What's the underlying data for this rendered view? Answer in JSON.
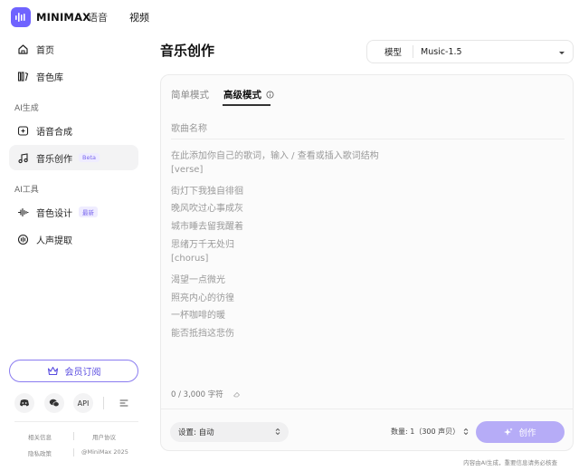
{
  "brand": {
    "name": "MINIMAX"
  },
  "top_nav": {
    "speech": "语音",
    "video": "视频"
  },
  "sidebar": {
    "home": "首页",
    "voice_library": "音色库",
    "section_ai_gen": "AI生成",
    "speech_synthesis": "语音合成",
    "music_creation": "音乐创作",
    "beta_badge": "Beta",
    "section_ai_tools": "AI工具",
    "voice_design": "音色设计",
    "new_badge": "最新",
    "vocal_extraction": "人声提取",
    "vip_button": "会员订阅",
    "api_label": "API",
    "footer": {
      "related_info": "相关信息",
      "user_agreement": "用户协议",
      "privacy_policy": "隐私政策",
      "copyright": "@MiniMax 2025"
    }
  },
  "main": {
    "title": "音乐创作",
    "model_label": "模型",
    "model_value": "Music-1.5",
    "tabs": {
      "simple": "简单模式",
      "advanced": "高级模式"
    },
    "song_name_placeholder": "歌曲名称",
    "lyrics_placeholder": "在此添加你自己的歌词，输入 / 查看或插入歌词结构",
    "lyrics": [
      "[verse]",
      "街灯下我独自徘徊",
      "晚风吹过心事成灰",
      "城市睡去留我醒着",
      "思绪万千无处归",
      "[chorus]",
      "渴望一点微光",
      "照亮内心的彷徨",
      "一杯咖啡的暖",
      "能否抵挡这悲伤"
    ],
    "char_counter": "0 / 3,000 字符",
    "settings": "设置: 自动",
    "count": "数量: 1（300 声贝）",
    "create_button": "创作",
    "disclaimer": "内容由AI生成，重要信息请务必核查"
  }
}
